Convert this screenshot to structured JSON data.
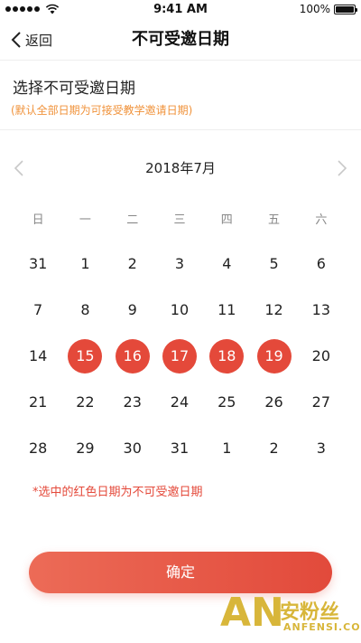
{
  "status_bar": {
    "time": "9:41 AM",
    "battery_text": "100%",
    "battery_level": 1.0,
    "icons": [
      "signal-icon",
      "wifi-icon",
      "battery-icon"
    ]
  },
  "nav": {
    "back_label": "返回",
    "title": "不可受邀日期",
    "back_icon": "chevron-left-icon"
  },
  "section": {
    "title": "选择不可受邀日期",
    "hint": "(默认全部日期为可接受教学邀请日期)"
  },
  "calendar": {
    "month_label": "2018年7月",
    "prev_icon": "chevron-left-icon",
    "next_icon": "chevron-right-icon",
    "weekdays": [
      "日",
      "一",
      "二",
      "三",
      "四",
      "五",
      "六"
    ],
    "days": [
      {
        "label": "31",
        "selected": false
      },
      {
        "label": "1",
        "selected": false
      },
      {
        "label": "2",
        "selected": false
      },
      {
        "label": "3",
        "selected": false
      },
      {
        "label": "4",
        "selected": false
      },
      {
        "label": "5",
        "selected": false
      },
      {
        "label": "6",
        "selected": false
      },
      {
        "label": "7",
        "selected": false
      },
      {
        "label": "8",
        "selected": false
      },
      {
        "label": "9",
        "selected": false
      },
      {
        "label": "10",
        "selected": false
      },
      {
        "label": "11",
        "selected": false
      },
      {
        "label": "12",
        "selected": false
      },
      {
        "label": "13",
        "selected": false
      },
      {
        "label": "14",
        "selected": false
      },
      {
        "label": "15",
        "selected": true
      },
      {
        "label": "16",
        "selected": true
      },
      {
        "label": "17",
        "selected": true
      },
      {
        "label": "18",
        "selected": true
      },
      {
        "label": "19",
        "selected": true
      },
      {
        "label": "20",
        "selected": false
      },
      {
        "label": "21",
        "selected": false
      },
      {
        "label": "22",
        "selected": false
      },
      {
        "label": "23",
        "selected": false
      },
      {
        "label": "24",
        "selected": false
      },
      {
        "label": "25",
        "selected": false
      },
      {
        "label": "26",
        "selected": false
      },
      {
        "label": "27",
        "selected": false
      },
      {
        "label": "28",
        "selected": false
      },
      {
        "label": "29",
        "selected": false
      },
      {
        "label": "30",
        "selected": false
      },
      {
        "label": "31",
        "selected": false
      },
      {
        "label": "1",
        "selected": false
      },
      {
        "label": "2",
        "selected": false
      },
      {
        "label": "3",
        "selected": false
      }
    ],
    "note": "*选中的红色日期为不可受邀日期"
  },
  "actions": {
    "confirm_label": "确定"
  },
  "watermark": {
    "logo_text": "AN",
    "cn_text": "安粉丝",
    "en_text": "ANFENSI.COM"
  },
  "colors": {
    "accent": "#e4493a",
    "hint": "#f0923a",
    "watermark": "#d8b63a"
  }
}
